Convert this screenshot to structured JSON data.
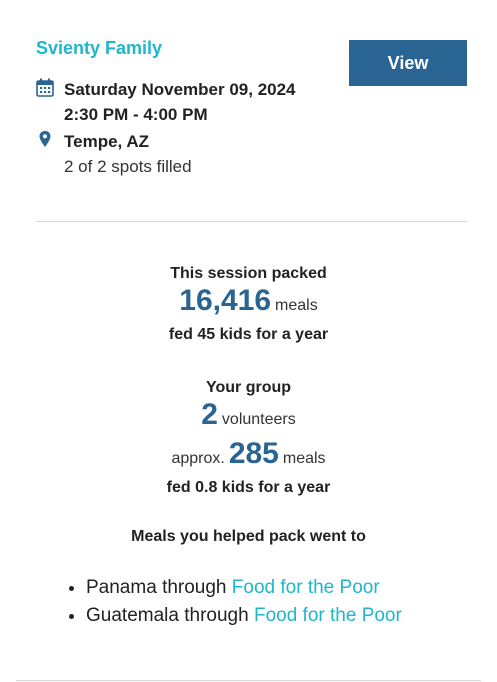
{
  "event": {
    "title": "Svienty Family",
    "view_label": "View",
    "date": "Saturday November 09, 2024",
    "time": "2:30 PM - 4:00 PM",
    "location": "Tempe, AZ",
    "spots": "2 of 2 spots filled",
    "icons": {
      "date": "calendar-icon",
      "location": "map-pin-icon"
    }
  },
  "session": {
    "heading": "This session packed",
    "meals_number": "16,416",
    "meals_unit": "meals",
    "fed_text": "fed 45 kids for a year"
  },
  "group": {
    "heading": "Your group",
    "volunteers_number": "2",
    "volunteers_unit": "volunteers",
    "approx_prefix": "approx.",
    "meals_number": "285",
    "meals_unit": "meals",
    "fed_text": "fed 0.8 kids for a year"
  },
  "destinations": {
    "heading": "Meals you helped pack went to",
    "items": [
      {
        "country": "Panama",
        "connector": "through",
        "partner": "Food for the Poor"
      },
      {
        "country": "Guatemala",
        "connector": "through",
        "partner": "Food for the Poor"
      }
    ]
  },
  "colors": {
    "accent_teal": "#1fb6cc",
    "brand_blue": "#2a6492",
    "divider": "#d6d6d6"
  }
}
